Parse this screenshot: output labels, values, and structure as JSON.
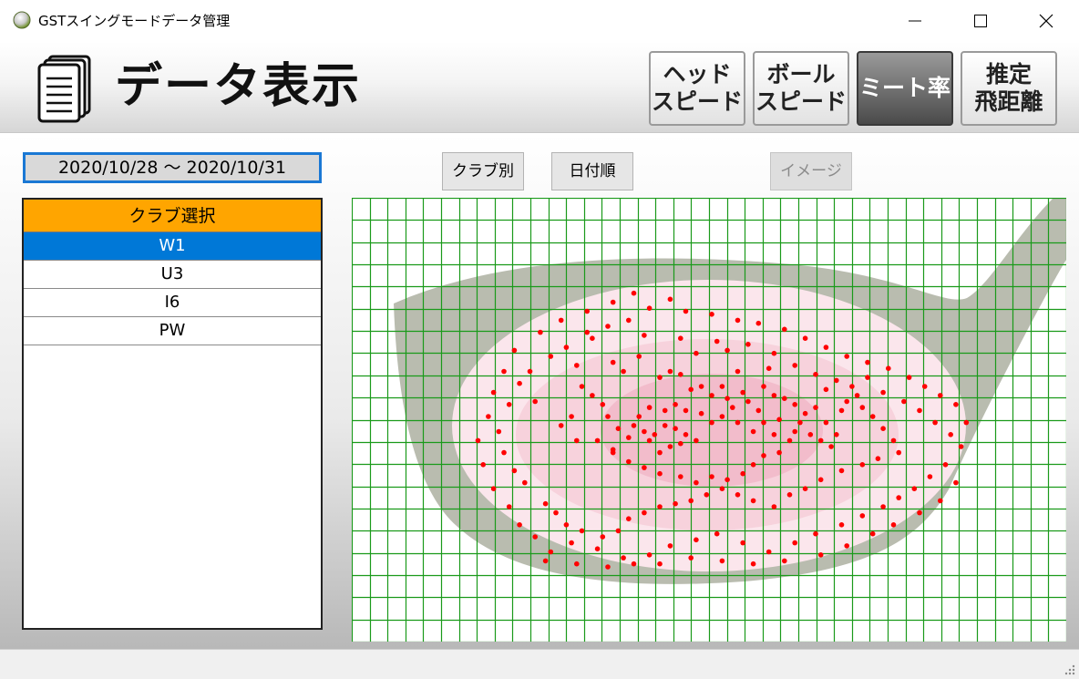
{
  "window": {
    "title": "GSTスイングモードデータ管理",
    "app_icon": "golf-ball-icon",
    "controls": [
      "minimize-icon",
      "maximize-icon",
      "close-icon"
    ]
  },
  "header": {
    "icon": "documents-icon",
    "title": "データ表示",
    "mode_buttons": [
      {
        "label": "ヘッド\nスピード",
        "active": false
      },
      {
        "label": "ボール\nスピード",
        "active": false
      },
      {
        "label": "ミート率",
        "active": true
      },
      {
        "label": "推定\n飛距離",
        "active": false
      }
    ]
  },
  "toolbar": {
    "date_range": "2020/10/28 ～ 2020/10/31",
    "club_sort_label": "クラブ別",
    "date_sort_label": "日付順",
    "image_label": "イメージ"
  },
  "club_list": {
    "header": "クラブ選択",
    "items": [
      "W1",
      "U3",
      "I6",
      "PW"
    ],
    "selected": "W1"
  },
  "colors": {
    "accent": "#0078d7",
    "club_header": "#ffa500",
    "grid": "#1a9a1a",
    "impact_dot": "#ff0000",
    "club_head": "#b9bcaf",
    "face_zone_outer": "#fbe6ec",
    "face_zone_mid": "#f7d2dc",
    "face_zone_inner": "#f2bccb"
  },
  "chart_data": {
    "type": "scatter",
    "description_of_axes": "",
    "grid": true,
    "points": [
      [
        0.38,
        0.14
      ],
      [
        0.42,
        0.11
      ],
      [
        0.27,
        0.24
      ],
      [
        0.24,
        0.33
      ],
      [
        0.16,
        0.45
      ],
      [
        0.53,
        0.28
      ],
      [
        0.47,
        0.29
      ],
      [
        0.42,
        0.35
      ],
      [
        0.4,
        0.37
      ],
      [
        0.44,
        0.36
      ],
      [
        0.55,
        0.35
      ],
      [
        0.61,
        0.34
      ],
      [
        0.6,
        0.4
      ],
      [
        0.56,
        0.42
      ],
      [
        0.52,
        0.4
      ],
      [
        0.48,
        0.4
      ],
      [
        0.46,
        0.41
      ],
      [
        0.5,
        0.43
      ],
      [
        0.53,
        0.44
      ],
      [
        0.54,
        0.47
      ],
      [
        0.57,
        0.45
      ],
      [
        0.59,
        0.48
      ],
      [
        0.62,
        0.43
      ],
      [
        0.64,
        0.44
      ],
      [
        0.66,
        0.46
      ],
      [
        0.68,
        0.49
      ],
      [
        0.7,
        0.47
      ],
      [
        0.72,
        0.41
      ],
      [
        0.67,
        0.52
      ],
      [
        0.63,
        0.51
      ],
      [
        0.6,
        0.52
      ],
      [
        0.58,
        0.55
      ],
      [
        0.55,
        0.52
      ],
      [
        0.52,
        0.5
      ],
      [
        0.5,
        0.52
      ],
      [
        0.48,
        0.49
      ],
      [
        0.45,
        0.48
      ],
      [
        0.43,
        0.46
      ],
      [
        0.41,
        0.48
      ],
      [
        0.38,
        0.47
      ],
      [
        0.36,
        0.5
      ],
      [
        0.35,
        0.53
      ],
      [
        0.37,
        0.55
      ],
      [
        0.39,
        0.56
      ],
      [
        0.41,
        0.53
      ],
      [
        0.43,
        0.54
      ],
      [
        0.45,
        0.56
      ],
      [
        0.47,
        0.58
      ],
      [
        0.44,
        0.59
      ],
      [
        0.42,
        0.6
      ],
      [
        0.4,
        0.62
      ],
      [
        0.38,
        0.58
      ],
      [
        0.34,
        0.57
      ],
      [
        0.32,
        0.54
      ],
      [
        0.3,
        0.5
      ],
      [
        0.29,
        0.46
      ],
      [
        0.27,
        0.43
      ],
      [
        0.25,
        0.4
      ],
      [
        0.23,
        0.5
      ],
      [
        0.21,
        0.53
      ],
      [
        0.24,
        0.58
      ],
      [
        0.28,
        0.58
      ],
      [
        0.31,
        0.61
      ],
      [
        0.31,
        0.62
      ],
      [
        0.34,
        0.65
      ],
      [
        0.37,
        0.67
      ],
      [
        0.4,
        0.69
      ],
      [
        0.44,
        0.7
      ],
      [
        0.47,
        0.72
      ],
      [
        0.5,
        0.7
      ],
      [
        0.53,
        0.71
      ],
      [
        0.56,
        0.69
      ],
      [
        0.58,
        0.66
      ],
      [
        0.6,
        0.63
      ],
      [
        0.63,
        0.62
      ],
      [
        0.65,
        0.58
      ],
      [
        0.62,
        0.56
      ],
      [
        0.66,
        0.55
      ],
      [
        0.69,
        0.56
      ],
      [
        0.71,
        0.58
      ],
      [
        0.73,
        0.6
      ],
      [
        0.74,
        0.56
      ],
      [
        0.72,
        0.52
      ],
      [
        0.75,
        0.48
      ],
      [
        0.76,
        0.45
      ],
      [
        0.78,
        0.43
      ],
      [
        0.79,
        0.47
      ],
      [
        0.81,
        0.5
      ],
      [
        0.83,
        0.54
      ],
      [
        0.85,
        0.58
      ],
      [
        0.86,
        0.62
      ],
      [
        0.82,
        0.64
      ],
      [
        0.79,
        0.66
      ],
      [
        0.75,
        0.68
      ],
      [
        0.71,
        0.71
      ],
      [
        0.68,
        0.74
      ],
      [
        0.65,
        0.76
      ],
      [
        0.62,
        0.8
      ],
      [
        0.58,
        0.78
      ],
      [
        0.55,
        0.76
      ],
      [
        0.52,
        0.74
      ],
      [
        0.49,
        0.76
      ],
      [
        0.46,
        0.78
      ],
      [
        0.43,
        0.79
      ],
      [
        0.4,
        0.8
      ],
      [
        0.37,
        0.82
      ],
      [
        0.34,
        0.84
      ],
      [
        0.32,
        0.88
      ],
      [
        0.29,
        0.9
      ],
      [
        0.25,
        0.88
      ],
      [
        0.22,
        0.86
      ],
      [
        0.2,
        0.82
      ],
      [
        0.18,
        0.79
      ],
      [
        0.14,
        0.72
      ],
      [
        0.12,
        0.68
      ],
      [
        0.1,
        0.62
      ],
      [
        0.09,
        0.55
      ],
      [
        0.11,
        0.46
      ],
      [
        0.13,
        0.39
      ],
      [
        0.15,
        0.35
      ],
      [
        0.19,
        0.3
      ],
      [
        0.22,
        0.27
      ],
      [
        0.26,
        0.22
      ],
      [
        0.3,
        0.2
      ],
      [
        0.34,
        0.18
      ],
      [
        0.37,
        0.23
      ],
      [
        0.36,
        0.3
      ],
      [
        0.33,
        0.35
      ],
      [
        0.31,
        0.32
      ],
      [
        0.44,
        0.24
      ],
      [
        0.51,
        0.25
      ],
      [
        0.57,
        0.26
      ],
      [
        0.62,
        0.29
      ],
      [
        0.66,
        0.33
      ],
      [
        0.7,
        0.36
      ],
      [
        0.74,
        0.38
      ],
      [
        0.77,
        0.4
      ],
      [
        0.8,
        0.37
      ],
      [
        0.83,
        0.42
      ],
      [
        0.87,
        0.45
      ],
      [
        0.9,
        0.48
      ],
      [
        0.93,
        0.52
      ],
      [
        0.96,
        0.56
      ],
      [
        0.98,
        0.6
      ],
      [
        0.95,
        0.66
      ],
      [
        0.92,
        0.7
      ],
      [
        0.89,
        0.74
      ],
      [
        0.86,
        0.77
      ],
      [
        0.83,
        0.8
      ],
      [
        0.79,
        0.83
      ],
      [
        0.75,
        0.86
      ],
      [
        0.7,
        0.89
      ],
      [
        0.66,
        0.92
      ],
      [
        0.61,
        0.95
      ],
      [
        0.56,
        0.92
      ],
      [
        0.51,
        0.89
      ],
      [
        0.47,
        0.91
      ],
      [
        0.42,
        0.93
      ],
      [
        0.38,
        0.96
      ],
      [
        0.33,
        0.97
      ],
      [
        0.28,
        0.94
      ],
      [
        0.23,
        0.92
      ],
      [
        0.19,
        0.95
      ],
      [
        0.16,
        0.9
      ],
      [
        0.13,
        0.86
      ],
      [
        0.11,
        0.8
      ],
      [
        0.08,
        0.74
      ],
      [
        0.06,
        0.66
      ],
      [
        0.05,
        0.58
      ],
      [
        0.07,
        0.5
      ],
      [
        0.08,
        0.42
      ],
      [
        0.1,
        0.35
      ],
      [
        0.12,
        0.28
      ],
      [
        0.17,
        0.22
      ],
      [
        0.21,
        0.18
      ],
      [
        0.26,
        0.15
      ],
      [
        0.31,
        0.12
      ],
      [
        0.35,
        0.09
      ],
      [
        0.45,
        0.15
      ],
      [
        0.5,
        0.16
      ],
      [
        0.55,
        0.18
      ],
      [
        0.59,
        0.19
      ],
      [
        0.64,
        0.21
      ],
      [
        0.68,
        0.24
      ],
      [
        0.72,
        0.27
      ],
      [
        0.76,
        0.3
      ],
      [
        0.8,
        0.32
      ],
      [
        0.84,
        0.34
      ],
      [
        0.88,
        0.37
      ],
      [
        0.91,
        0.4
      ],
      [
        0.94,
        0.43
      ],
      [
        0.97,
        0.46
      ],
      [
        0.99,
        0.52
      ],
      [
        0.97,
        0.72
      ],
      [
        0.94,
        0.78
      ],
      [
        0.9,
        0.82
      ],
      [
        0.85,
        0.86
      ],
      [
        0.81,
        0.89
      ],
      [
        0.76,
        0.93
      ],
      [
        0.71,
        0.96
      ],
      [
        0.64,
        0.98
      ],
      [
        0.58,
        0.99
      ],
      [
        0.52,
        0.98
      ],
      [
        0.46,
        0.97
      ],
      [
        0.4,
        0.99
      ],
      [
        0.35,
        0.99
      ],
      [
        0.3,
        1.0
      ],
      [
        0.24,
        0.99
      ],
      [
        0.18,
        0.98
      ]
    ]
  }
}
